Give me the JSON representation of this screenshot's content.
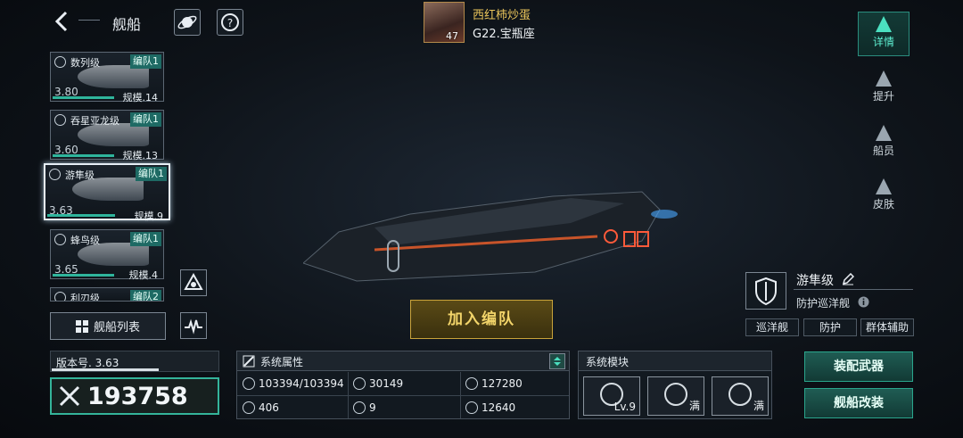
{
  "header": {
    "title": "舰船"
  },
  "player": {
    "name": "西红柿炒蛋",
    "level": "47",
    "server": "G22.宝瓶座"
  },
  "ships": [
    {
      "name": "数列级",
      "team": "编队1",
      "power": "3.80",
      "scale": "规模.14",
      "progress": 0.55
    },
    {
      "name": "吞星亚龙级",
      "team": "编队1",
      "power": "3.60",
      "scale": "规模.13",
      "progress": 0.55
    },
    {
      "name": "游隼级",
      "team": "编队1",
      "power": "3.63",
      "scale": "规模.9",
      "progress": 0.55
    },
    {
      "name": "蜂鸟级",
      "team": "编队1",
      "power": "3.65",
      "scale": "规模.4",
      "progress": 0.55
    },
    {
      "name": "利刃级",
      "team": "编队2",
      "power": "",
      "scale": "",
      "progress": 0.5
    }
  ],
  "ship_list_label": "舰船列表",
  "version": {
    "label": "版本号. 3.63",
    "progress": 0.8
  },
  "combat_power": "193758",
  "join_fleet": "加入编队",
  "attributes": {
    "title": "系统属性",
    "items": [
      "103394/103394",
      "30149",
      "127280",
      "406",
      "9",
      "12640"
    ]
  },
  "modules": {
    "title": "系统模块",
    "items": [
      {
        "text": "Lv.9"
      },
      {
        "text": "满"
      },
      {
        "text": "满"
      }
    ]
  },
  "right_tabs": [
    {
      "label": "详情"
    },
    {
      "label": "提升"
    },
    {
      "label": "船员"
    },
    {
      "label": "皮肤"
    }
  ],
  "selected_ship": {
    "name": "游隼级",
    "class": "防护巡洋舰",
    "tags": [
      "巡洋舰",
      "防护",
      "群体辅助"
    ]
  },
  "actions": {
    "equip": "装配武器",
    "modify": "舰船改装"
  },
  "colors": {
    "accent": "#34b49a",
    "gold": "#e8c35a"
  }
}
